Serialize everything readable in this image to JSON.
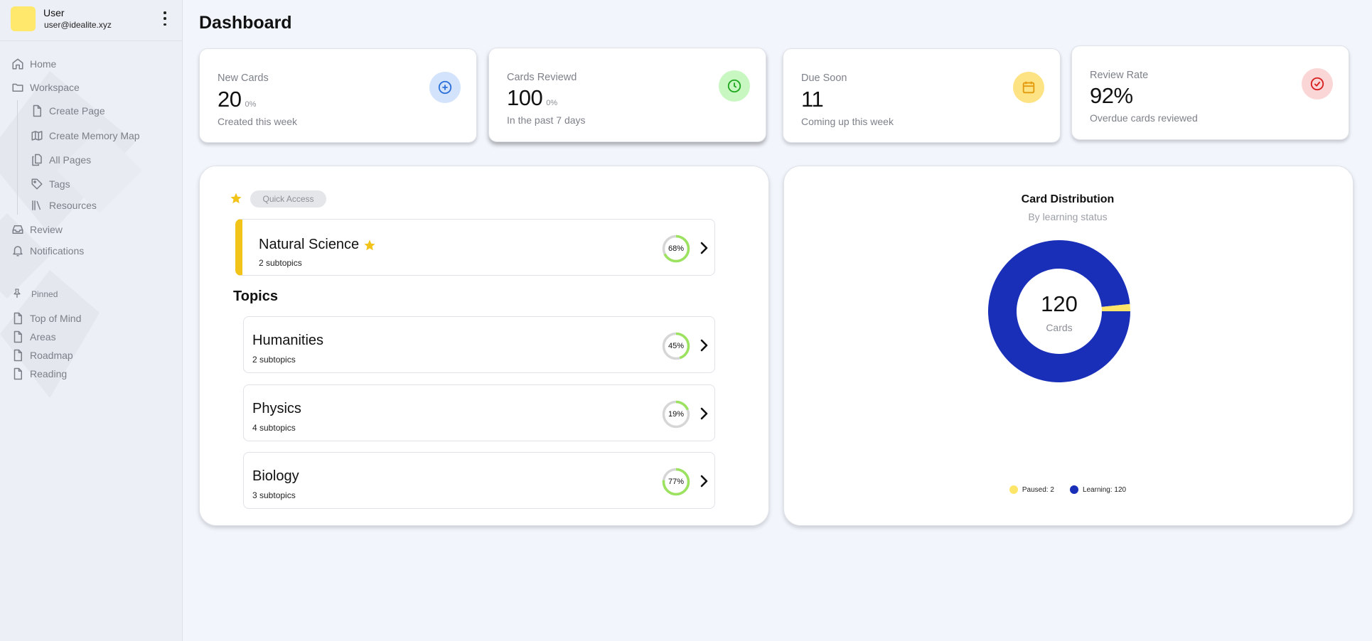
{
  "user": {
    "name": "User",
    "email": "user@idealite.xyz"
  },
  "nav": {
    "home": "Home",
    "workspace": "Workspace",
    "create_page": "Create Page",
    "create_memory_map": "Create Memory Map",
    "all_pages": "All Pages",
    "tags": "Tags",
    "resources": "Resources",
    "review": "Review",
    "notifications": "Notifications"
  },
  "pinned": {
    "label": "Pinned",
    "items": [
      "Top of Mind",
      "Areas",
      "Roadmap",
      "Reading"
    ]
  },
  "page_title": "Dashboard",
  "stats": [
    {
      "label": "New Cards",
      "value": "20",
      "pct": "0%",
      "sub": "Created this week",
      "icon": "plus-circle-icon",
      "icon_bg": "#d3e3fb",
      "icon_color": "#2b6fd8"
    },
    {
      "label": "Cards Reviewd",
      "value": "100",
      "pct": "0%",
      "sub": "In the past 7 days",
      "icon": "clock-icon",
      "icon_bg": "#c8f7c1",
      "icon_color": "#1ea81e"
    },
    {
      "label": "Due Soon",
      "value": "11",
      "pct": "",
      "sub": "Coming up this week",
      "icon": "calendar-icon",
      "icon_bg": "#fde383",
      "icon_color": "#e39a0c"
    },
    {
      "label": "Review Rate",
      "value": "92%",
      "pct": "",
      "sub": "Overdue cards reviewed",
      "icon": "check-circle-icon",
      "icon_bg": "#fbd6d6",
      "icon_color": "#d81f1f"
    }
  ],
  "quick_access": {
    "label": "Quick Access",
    "featured": {
      "name": "Natural Science",
      "sub": "2 subtopics",
      "progress": 68,
      "progress_label": "68%"
    }
  },
  "topics": {
    "title": "Topics",
    "items": [
      {
        "name": "Humanities",
        "sub": "2 subtopics",
        "progress": 45,
        "progress_label": "45%"
      },
      {
        "name": "Physics",
        "sub": "4 subtopics",
        "progress": 19,
        "progress_label": "19%"
      },
      {
        "name": "Biology",
        "sub": "3 subtopics",
        "progress": 77,
        "progress_label": "77%"
      }
    ]
  },
  "colors": {
    "accent_yellow": "#f2c318",
    "progress_green": "#9be35e",
    "progress_track": "#d6d6d6",
    "learning_blue": "#1a2fb8",
    "paused_yellow": "#fde56a"
  },
  "chart_data": {
    "type": "pie",
    "title": "Card Distribution",
    "subtitle": "By learning status",
    "center_value": "120",
    "center_label": "Cards",
    "series": [
      {
        "name": "Paused",
        "value": 2,
        "color": "#fde56a",
        "legend": "Paused: 2"
      },
      {
        "name": "Learning",
        "value": 120,
        "color": "#1a2fb8",
        "legend": "Learning: 120"
      }
    ],
    "legend_position": "bottom"
  }
}
